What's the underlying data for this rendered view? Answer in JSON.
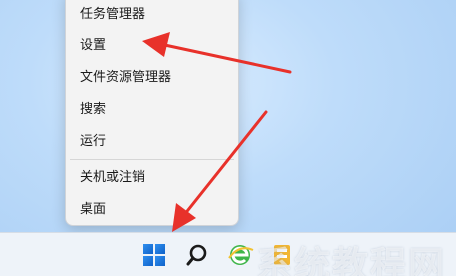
{
  "context_menu": {
    "items": [
      {
        "label": "任务管理器"
      },
      {
        "label": "设置"
      },
      {
        "label": "文件资源管理器"
      },
      {
        "label": "搜索"
      },
      {
        "label": "运行"
      },
      {
        "label": "关机或注销"
      },
      {
        "label": "桌面"
      }
    ]
  },
  "taskbar": {
    "icons": [
      "windows-start-icon",
      "search-icon",
      "browser-icon",
      "app-icon"
    ]
  },
  "watermark": {
    "text": "系统教程网"
  },
  "colors": {
    "arrow": "#e8312a",
    "menu_bg": "#f3f3f3",
    "taskbar_bg": "#eef3f9",
    "start_blue": "#1e7be0"
  }
}
